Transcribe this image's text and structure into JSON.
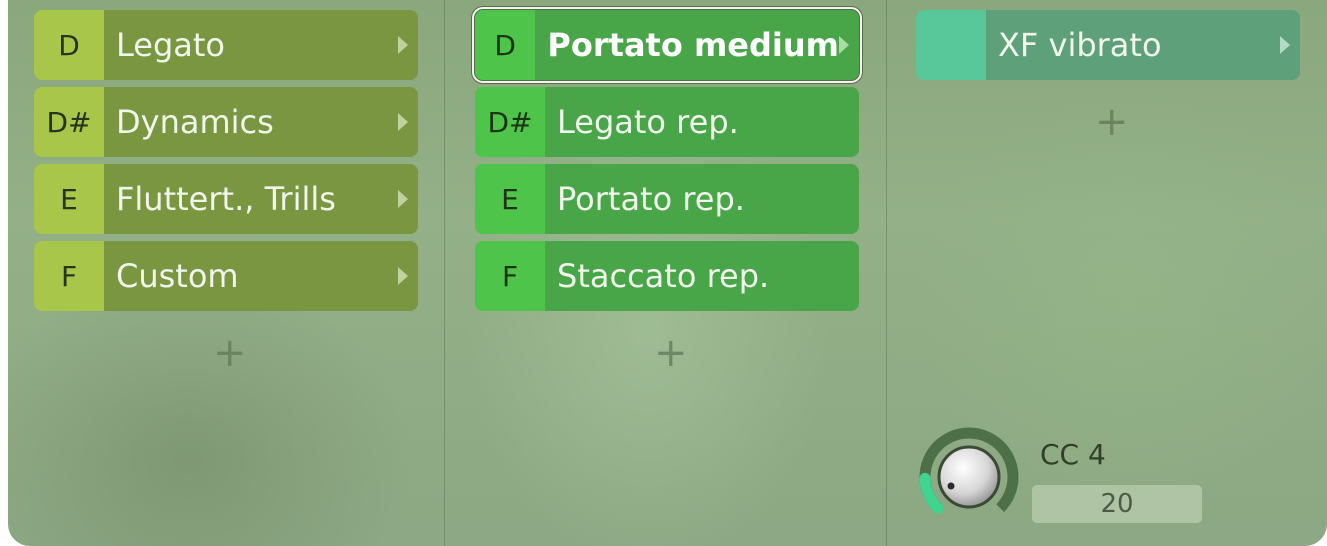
{
  "columns": [
    {
      "items": [
        {
          "key": "D",
          "label": "Legato"
        },
        {
          "key": "D#",
          "label": "Dynamics"
        },
        {
          "key": "E",
          "label": "Fluttert., Trills"
        },
        {
          "key": "F",
          "label": "Custom"
        }
      ],
      "add_label": "+"
    },
    {
      "items": [
        {
          "key": "D",
          "label": "Portato medium",
          "selected": true
        },
        {
          "key": "D#",
          "label": "Legato rep."
        },
        {
          "key": "E",
          "label": "Portato rep."
        },
        {
          "key": "F",
          "label": "Staccato rep."
        }
      ],
      "add_label": "+"
    },
    {
      "items": [
        {
          "key": "",
          "label": "XF vibrato"
        }
      ],
      "add_label": "+"
    }
  ],
  "controller": {
    "label": "CC 4",
    "value": "20",
    "level": 0.16
  },
  "colors": {
    "column1_row": "#7a9640",
    "column1_key": "#a8c64a",
    "column2_row": "#48a548",
    "column2_key": "#4ec54a",
    "column3_row": "#5ea07a",
    "column3_key": "#58c79a",
    "knob_ring_active": "#3fd48f"
  },
  "icons": {
    "submenu_arrow": "triangle-right",
    "add": "plus",
    "knob": "rotary-knob"
  }
}
